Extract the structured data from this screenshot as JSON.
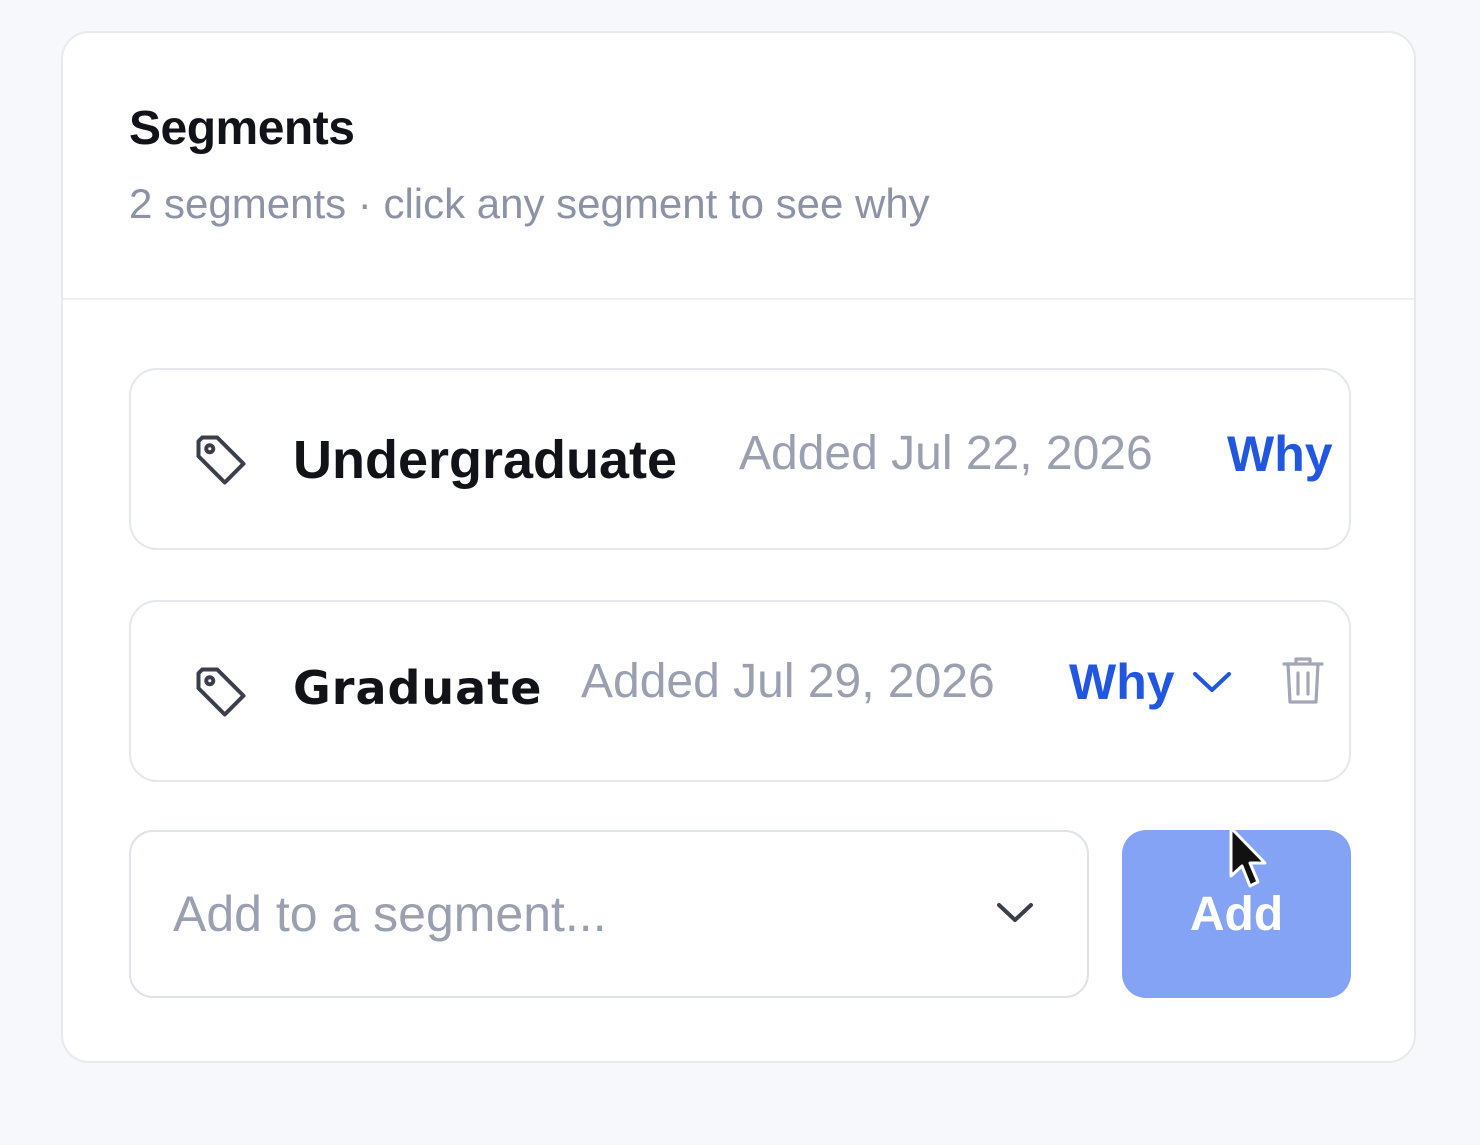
{
  "header": {
    "title": "Segments",
    "subtitle": "2 segments · click any segment to see why"
  },
  "segments": [
    {
      "name": "Undergraduate",
      "added": "Added Jul 22, 2026",
      "why_label": "Why",
      "icon": "tag-icon"
    },
    {
      "name": "Graduate",
      "added": "Added Jul 29, 2026",
      "why_label": "Why",
      "icon": "tag-icon",
      "expand_icon": "chevron-down-icon",
      "delete_icon": "trash-icon"
    }
  ],
  "add_form": {
    "placeholder": "Add to a segment...",
    "button_label": "Add"
  },
  "colors": {
    "accent": "#2157e0",
    "button": "#84a3f5",
    "muted_text": "#9aa0b0"
  }
}
